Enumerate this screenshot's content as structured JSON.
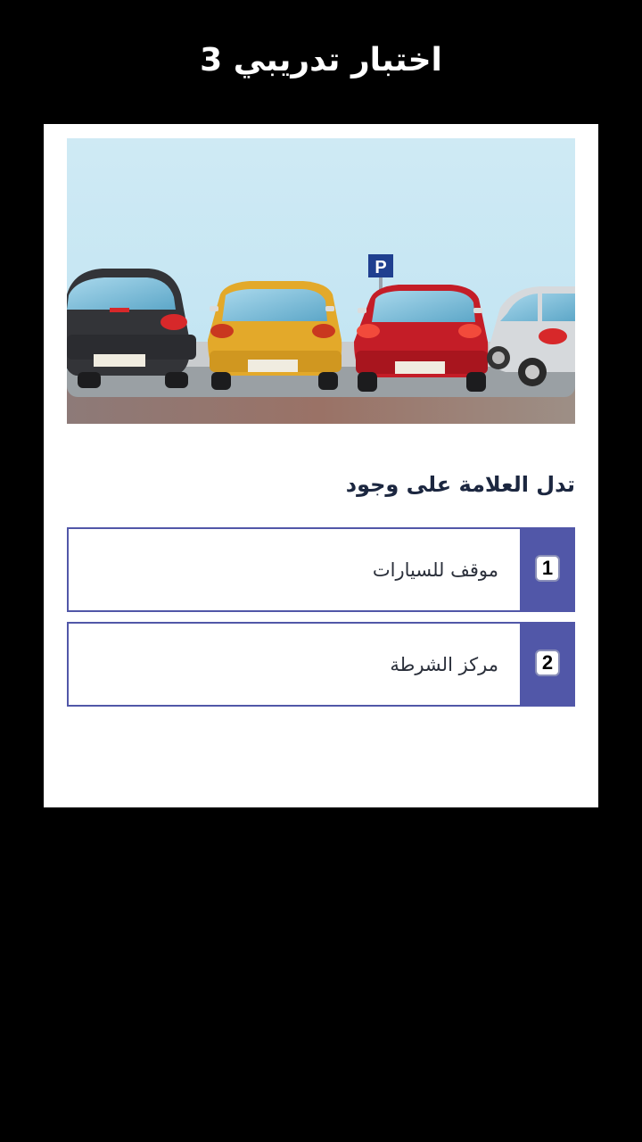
{
  "header": {
    "title": "اختبار تدريبي 3"
  },
  "question": {
    "image_icon": "parking-lot-illustration",
    "parking_sign": "P",
    "text": "تدل العلامة على وجود"
  },
  "answers": [
    {
      "number": "1",
      "label": "موقف للسيارات"
    },
    {
      "number": "2",
      "label": "مركز الشرطة"
    }
  ],
  "colors": {
    "background": "#000000",
    "card": "#ffffff",
    "accent": "#5157a8",
    "question_text": "#1c2740",
    "sign_blue": "#1f3f8f"
  }
}
